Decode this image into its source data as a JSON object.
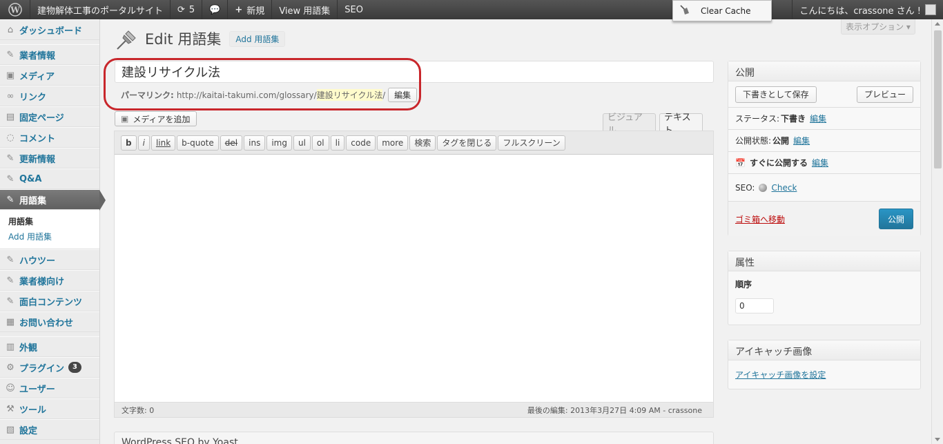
{
  "adminbar": {
    "site_name": "建物解体工事のポータルサイト",
    "updates_count": "5",
    "new_label": "新規",
    "view_label": "View 用語集",
    "seo_label": "SEO",
    "clear_cache": "Clear Cache",
    "greeting": "こんにちは、crassone さん !"
  },
  "sidebar": {
    "items": [
      {
        "label": "ダッシュボード",
        "icon": "⌂"
      },
      {
        "label": "業者情報",
        "icon": "✎"
      },
      {
        "label": "メディア",
        "icon": "▣"
      },
      {
        "label": "リンク",
        "icon": "∞"
      },
      {
        "label": "固定ページ",
        "icon": "▤"
      },
      {
        "label": "コメント",
        "icon": "◌"
      },
      {
        "label": "更新情報",
        "icon": "✎"
      },
      {
        "label": "Q&A",
        "icon": "✎"
      },
      {
        "label": "用語集",
        "icon": "✎"
      },
      {
        "label": "ハウツー",
        "icon": "✎"
      },
      {
        "label": "業者様向け",
        "icon": "✎"
      },
      {
        "label": "面白コンテンツ",
        "icon": "✎"
      },
      {
        "label": "お問い合わせ",
        "icon": "▦"
      },
      {
        "label": "外観",
        "icon": "▥"
      },
      {
        "label": "プラグイン",
        "icon": "⚙"
      },
      {
        "label": "ユーザー",
        "icon": "☺"
      },
      {
        "label": "ツール",
        "icon": "⚒"
      },
      {
        "label": "設定",
        "icon": "▧"
      }
    ],
    "plugin_badge": "3",
    "submenu": [
      "用語集",
      "Add 用語集"
    ]
  },
  "screen_options": "表示オプション ▾",
  "page": {
    "title": "Edit 用語集",
    "add_new": "Add 用語集",
    "post_title": "建設リサイクル法",
    "permalink_label": "パーマリンク:",
    "permalink_base": "http://kaitai-takumi.com/glossary/",
    "permalink_slug": "建設リサイクル法",
    "permalink_end": "/",
    "permalink_edit": "編集",
    "add_media": "メディアを追加"
  },
  "editor": {
    "tab_visual": "ビジュアル",
    "tab_text": "テキスト",
    "quicktags": [
      "b",
      "i",
      "link",
      "b-quote",
      "del",
      "ins",
      "img",
      "ul",
      "ol",
      "li",
      "code",
      "more",
      "検索",
      "タグを閉じる",
      "フルスクリーン"
    ],
    "word_count": "文字数: 0",
    "last_edit": "最後の編集: 2013年3月27日 4:09 AM - crassone"
  },
  "seo_box_title": "WordPress SEO by Yoast",
  "publish": {
    "title": "公開",
    "save_draft": "下書きとして保存",
    "preview": "プレビュー",
    "status_label": "ステータス:",
    "status_value": "下書き",
    "visibility_label": "公開状態:",
    "visibility_value": "公開",
    "schedule": "すぐに公開する",
    "edit_link": "編集",
    "seo_label": "SEO:",
    "seo_check": "Check",
    "trash": "ゴミ箱へ移動",
    "publish_btn": "公開"
  },
  "attributes": {
    "title": "属性",
    "order_label": "順序",
    "order_value": "0"
  },
  "thumbnail": {
    "title": "アイキャッチ画像",
    "set_link": "アイキャッチ画像を設定"
  }
}
